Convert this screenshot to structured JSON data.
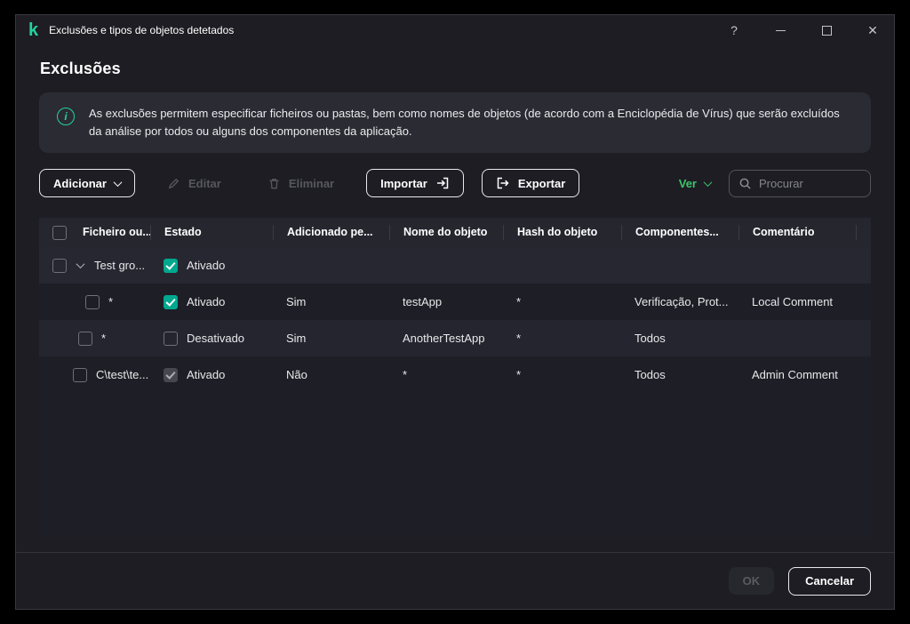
{
  "window": {
    "title": "Exclusões e tipos de objetos detetados",
    "controls": {
      "help": "?"
    }
  },
  "page": {
    "title": "Exclusões"
  },
  "banner": {
    "text": "As exclusões permitem especificar ficheiros ou pastas, bem como nomes de objetos (de acordo com a Enciclopédia de Vírus) que serão excluídos da análise por todos ou alguns dos componentes da aplicação."
  },
  "toolbar": {
    "add_label": "Adicionar",
    "edit_label": "Editar",
    "delete_label": "Eliminar",
    "import_label": "Importar",
    "export_label": "Exportar",
    "view_label": "Ver",
    "search_placeholder": "Procurar"
  },
  "table": {
    "columns": {
      "file": "Ficheiro ou...",
      "state": "Estado",
      "added": "Adicionado pe...",
      "name": "Nome do objeto",
      "hash": "Hash do objeto",
      "components": "Componentes...",
      "comment": "Comentário"
    },
    "rows": [
      {
        "file": "Test gro...",
        "state": "Ativado",
        "state_checked": true,
        "is_group": true,
        "added": "",
        "name": "",
        "hash": "",
        "components": "",
        "comment": ""
      },
      {
        "file": "*",
        "state": "Ativado",
        "state_checked": true,
        "added": "Sim",
        "name": "testApp",
        "hash": "*",
        "components": "Verificação, Prot...",
        "comment": "Local Comment"
      },
      {
        "file": "*",
        "state": "Desativado",
        "state_checked": false,
        "added": "Sim",
        "name": "AnotherTestApp",
        "hash": "*",
        "components": "Todos",
        "comment": ""
      },
      {
        "file": "C\\test\\te...",
        "state": "Ativado",
        "state_checked": true,
        "state_locked": true,
        "added": "Não",
        "name": "*",
        "hash": "*",
        "components": "Todos",
        "comment": "Admin Comment"
      }
    ]
  },
  "footer": {
    "ok_label": "OK",
    "cancel_label": "Cancelar"
  },
  "colors": {
    "accent_green": "#23d1a0",
    "checkbox_green": "#00a88e",
    "link_green": "#3ec46d"
  },
  "icons": [
    "kaspersky-logo",
    "help-icon",
    "minimize-icon",
    "maximize-icon",
    "close-icon",
    "info-icon",
    "chevron-down-icon",
    "pencil-icon",
    "trash-icon",
    "import-icon",
    "export-icon",
    "search-icon"
  ]
}
